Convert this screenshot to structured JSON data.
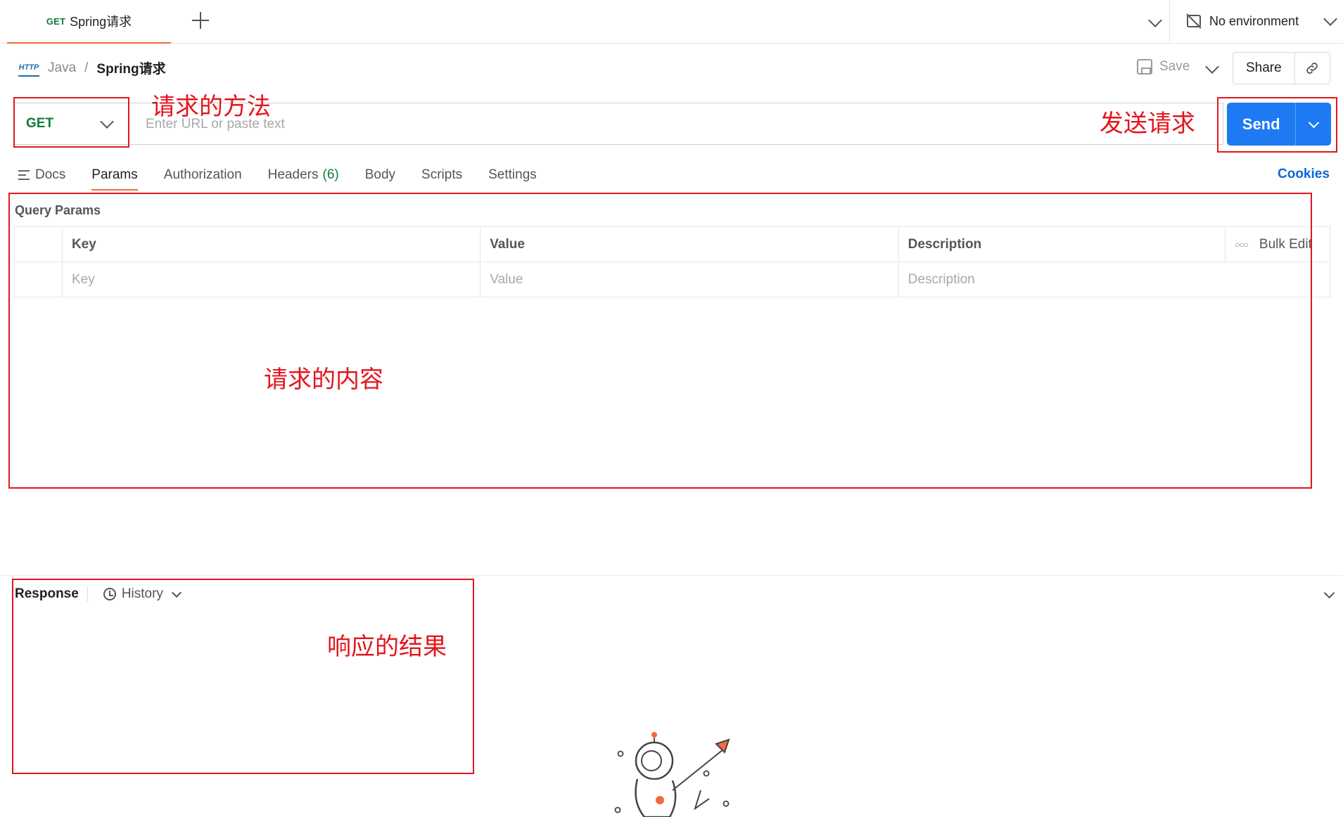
{
  "tab": {
    "method": "GET",
    "name": "Spring请求"
  },
  "environment": {
    "label": "No environment"
  },
  "breadcrumb": {
    "collection": "Java",
    "separator": "/",
    "current": "Spring请求"
  },
  "toolbar": {
    "save_label": "Save",
    "share_label": "Share"
  },
  "request": {
    "method": "GET",
    "url_placeholder": "Enter URL or paste text",
    "send_label": "Send"
  },
  "request_tabs": [
    {
      "label": "Docs"
    },
    {
      "label": "Params",
      "active": true
    },
    {
      "label": "Authorization"
    },
    {
      "label": "Headers",
      "count": "(6)"
    },
    {
      "label": "Body"
    },
    {
      "label": "Scripts"
    },
    {
      "label": "Settings"
    }
  ],
  "cookies_label": "Cookies",
  "query_params": {
    "title": "Query Params",
    "headers": {
      "key": "Key",
      "value": "Value",
      "description": "Description",
      "bulk_edit": "Bulk Edit"
    },
    "row_placeholders": {
      "key": "Key",
      "value": "Value",
      "description": "Description"
    }
  },
  "response": {
    "title": "Response",
    "history_label": "History"
  },
  "annotations": {
    "method": "请求的方法",
    "send": "发送请求",
    "content": "请求的内容",
    "result": "响应的结果"
  },
  "colors": {
    "accent_orange": "#f26b3a",
    "send_blue": "#1d7af3",
    "get_green": "#0f7b3c",
    "annotation_red": "#e3161d",
    "link_blue": "#0b68d6"
  }
}
